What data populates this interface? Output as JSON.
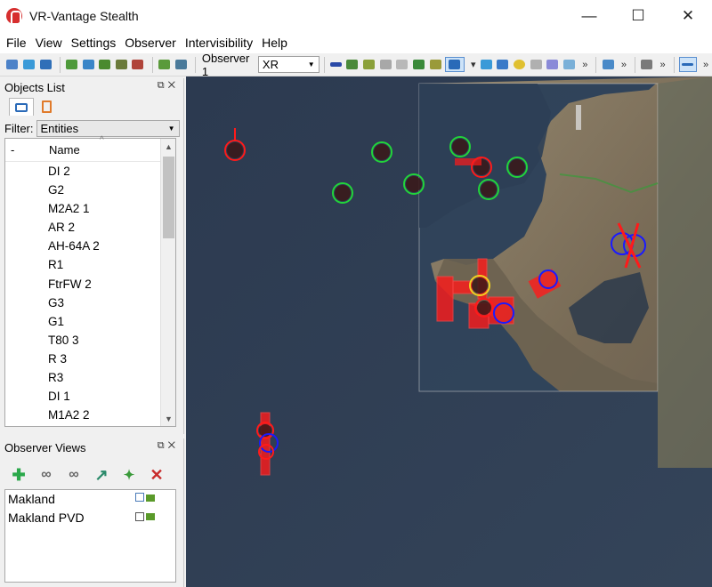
{
  "window": {
    "title": "VR-Vantage Stealth",
    "controls": {
      "minimize": "—",
      "maximize": "☐",
      "close": "✕"
    }
  },
  "menu": [
    "File",
    "View",
    "Settings",
    "Observer",
    "Intervisibility",
    "Help"
  ],
  "toolbar": {
    "observer_label": "Observer 1",
    "mode_value": "XR",
    "more": "»"
  },
  "objects_list": {
    "title": "Objects List",
    "filter_label": "Filter:",
    "filter_value": "Entities",
    "column_dash": "-",
    "column_name": "Name",
    "items": [
      "DI 2",
      "G2",
      "M2A2 1",
      "AR 2",
      "AH-64A 2",
      "R1",
      "FtrFW 2",
      "G3",
      "G1",
      "T80 3",
      "R 3",
      "R3",
      "DI 1",
      "M1A2 2"
    ]
  },
  "observer_views": {
    "title": "Observer Views",
    "items": [
      "Makland",
      "Makland PVD"
    ]
  },
  "colors": {
    "friendly": "#22d43a",
    "hostile": "#ff1a1a",
    "neutral": "#1a1aff",
    "selected": "#f0d020",
    "water": "#2f3d52",
    "land": "#8b7d67"
  }
}
